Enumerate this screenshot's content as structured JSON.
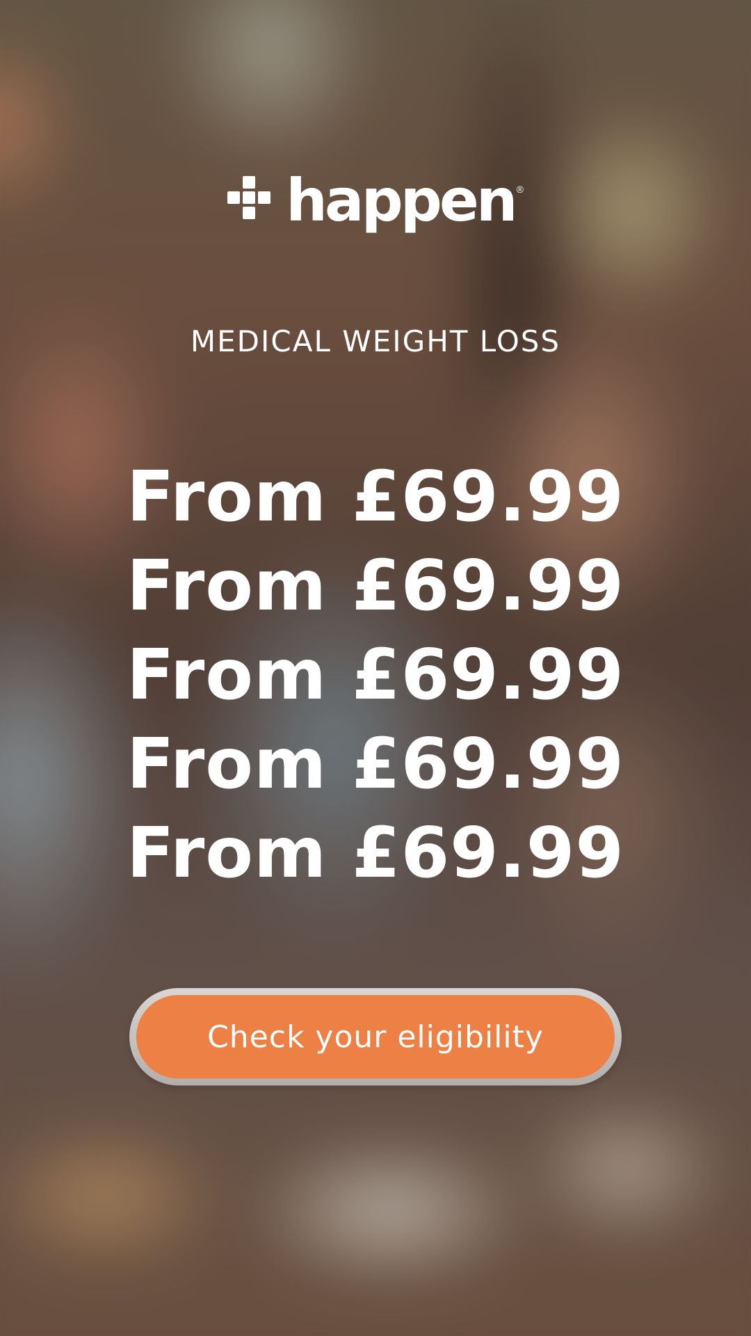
{
  "brand": {
    "name": "happen",
    "registered_mark": "®",
    "logo_icon": "plus-cross-icon"
  },
  "eyebrow": "MEDICAL WEIGHT LOSS",
  "price_lines": [
    "From £69.99",
    "From £69.99",
    "From £69.99",
    "From £69.99",
    "From £69.99"
  ],
  "cta": {
    "label": "Check your eligibility"
  },
  "colors": {
    "accent": "#ec8045",
    "text": "#ffffff"
  }
}
